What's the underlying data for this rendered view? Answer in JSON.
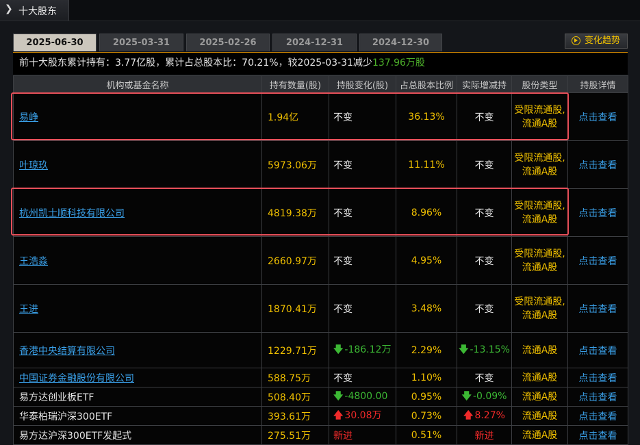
{
  "window": {
    "title": "十大股东"
  },
  "tabs": [
    "2025-06-30",
    "2025-03-31",
    "2025-02-26",
    "2024-12-31",
    "2024-12-30"
  ],
  "trend_button": "变化趋势",
  "summary": {
    "p1": "前十大股东累计持有：",
    "total": "3.77亿股",
    "p2": "，累计占总股本比：",
    "ratio": "70.21%",
    "p3": "，较2025-03-31减少",
    "decrease": "137.96万股"
  },
  "columns": [
    "机构或基金名称",
    "持有数量(股)",
    "持股变化(股)",
    "占总股本比例",
    "实际增减持",
    "股份类型",
    "持股详情"
  ],
  "rows": [
    {
      "name": "易峥",
      "link": true,
      "qty": "1.94亿",
      "change": "不变",
      "pct": "36.13%",
      "actual": "不变",
      "stype": "受限流通股,流通A股",
      "detail": "点击查看"
    },
    {
      "name": "叶琼玖",
      "link": true,
      "qty": "5973.06万",
      "change": "不变",
      "pct": "11.11%",
      "actual": "不变",
      "stype": "受限流通股,流通A股",
      "detail": "点击查看"
    },
    {
      "name": "杭州凯士顺科技有限公司",
      "link": true,
      "qty": "4819.38万",
      "change": "不变",
      "pct": "8.96%",
      "actual": "不变",
      "stype": "受限流通股,流通A股",
      "detail": "点击查看"
    },
    {
      "name": "王浩淼",
      "link": true,
      "qty": "2660.97万",
      "change": "不变",
      "pct": "4.95%",
      "actual": "不变",
      "stype": "受限流通股,流通A股",
      "detail": "点击查看"
    },
    {
      "name": "王进",
      "link": true,
      "qty": "1870.41万",
      "change": "不变",
      "pct": "3.48%",
      "actual": "不变",
      "stype": "受限流通股,流通A股",
      "detail": "点击查看"
    },
    {
      "name": "香港中央结算有限公司",
      "link": true,
      "qty": "1229.71万",
      "change": "-186.12万",
      "pct": "2.29%",
      "actual": "-13.15%",
      "stype": "流通A股",
      "detail": "点击查看"
    },
    {
      "name": "中国证券金融股份有限公司",
      "link": true,
      "qty": "588.75万",
      "change": "不变",
      "pct": "1.10%",
      "actual": "不变",
      "stype": "流通A股",
      "detail": "点击查看"
    },
    {
      "name": "易方达创业板ETF",
      "link": false,
      "qty": "508.40万",
      "change": "-4800.00",
      "pct": "0.95%",
      "actual": "-0.09%",
      "stype": "流通A股",
      "detail": "点击查看"
    },
    {
      "name": "华泰柏瑞沪深300ETF",
      "link": false,
      "qty": "393.61万",
      "change": "30.08万",
      "pct": "0.73%",
      "actual": "8.27%",
      "stype": "流通A股",
      "detail": "点击查看"
    },
    {
      "name": "易方达沪深300ETF发起式",
      "link": false,
      "qty": "275.51万",
      "change": "新进",
      "pct": "0.51%",
      "actual": "新进",
      "stype": "流通A股",
      "detail": "点击查看"
    }
  ]
}
